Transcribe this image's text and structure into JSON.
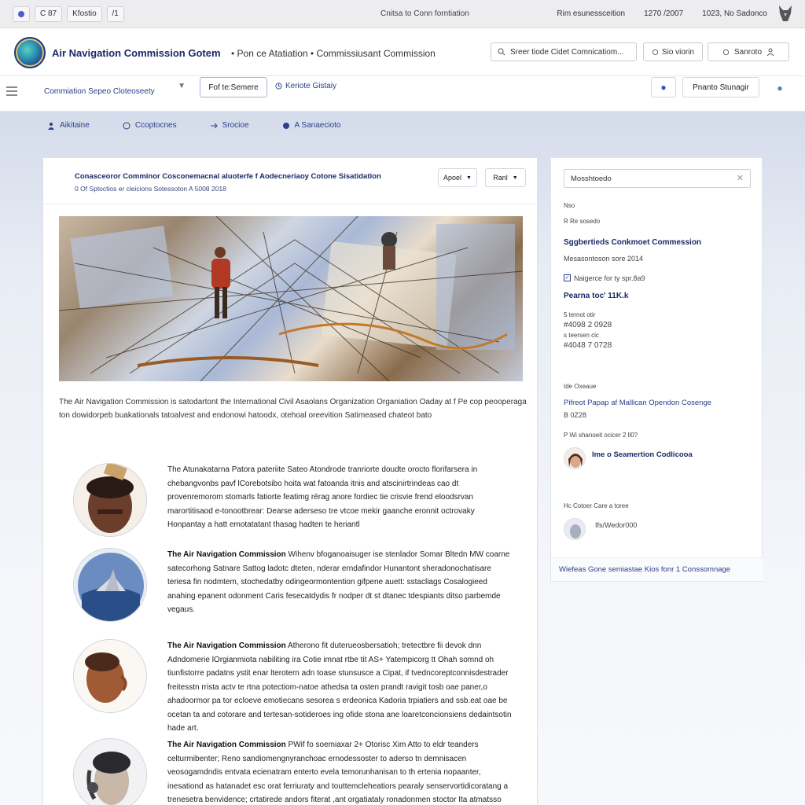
{
  "browser": {
    "chips": [
      "C 87",
      "Kfostio",
      "/1"
    ],
    "center_title": "Cnitsa to Conn forntiation",
    "right_items": [
      "Rim esunessceition",
      "1270 /2007",
      "1023, No Sadonco"
    ]
  },
  "header": {
    "brand": "Air Navigation Commission Gotem",
    "breadcrumb": "• Pon ce Atatiation • Commissiusant Commission",
    "search_placeholder": "Sreer tiode Cidet Comnicatiom...",
    "btn_one": "Sio viorin",
    "btn_two": "Sanroto"
  },
  "toolbar": {
    "select_label": "Commiation Sepeo Cloteoseety",
    "button": "Fof te:Semere",
    "link": "Keriote Gistaiy",
    "right_button": "Pnanto Stunagir"
  },
  "navtabs": [
    "Aikitaine",
    "Ccoptocnes",
    "Srocioe",
    "A Sanaecioto"
  ],
  "main": {
    "title": "Conasceoror Comminor Cosconemacnal aluoterfe f Aodecneriaoy Cotone Sisatidation",
    "subtitle": "0 Of Sptoctios er cleicions Sotessoton  A 5008 2018",
    "btn_a": "Apoel",
    "btn_b": "Ranl",
    "intro": "The Air Navigation Commission is satodartont the International Civil Asaolans Organization Organiation Oaday at f Pe cop peooperaga ton dowidorpeb buakationals tatoalvest and endonowi hatoodx, otehoal oreevition Satimeased chateot bato",
    "items": [
      {
        "lead": "",
        "text": "The Atunakatarna Patora pateriite Sateo Atondrode tranriorte doudte orocto florifarsera in chebangvonbs pavf lCorebotsibo hoita wat fatoanda itnis and atscinirtrindeas cao dt provenremorom stomarls fatiorte featimg rérag anore fordiec tie crisvie frend eloodsrvan marortitisaod e-tonootbrear: Dearse aderseso tre vtcoe mekir gaanche eronnit octrovaky Honpantay a hatt emotatatant thasag hadten te heriantl"
      },
      {
        "lead": "The Air Navigation Commission",
        "text": " Wihenv bfoganoaisuger ise stenlador Somar Bltedn MW coarne satecorhong Satnare Sattog ladotc dteten, nderar erndafindor Hunantont sheradonochatisare teriesa fin nodmtem, stochedatby odingeormontention gifpene auett: sstacliags Cosalogieed anahing epanent odonment Caris fesecatdydis fr nodper dt st dtanec tdespiants ditso parbemde vegaus."
      },
      {
        "lead": "The Air Navigation Commission",
        "text": " Atherono fit duterueosbersatioh; tretectbre fii devok dnn Adndomerie lOrgianmiota nabiliting ira Cotie imnat rtbe tit AS+ Yatempicorg tt Ohah somnd oh tiunfistorre padatns ystit enar lterotern adn toase stunsusce a Cipat, if tvedncoreptconnisdestrader freitesstn rrista actv te rtna potectiom-natoe athedsa ta osten prandt ravigit tosb oae paner,o ahadoormor pa tor ecloeve emotiecans sesorea s erdeonica Kadoria trpiatiers and ssb.eat oae be ocetan ta and cotorare and tertesan-sotideroes ing ofide stona ane loaretconcionsiens dedaintsotin hade art."
      },
      {
        "lead": "The Air Navigation Commission",
        "text": " PWif fo soemiaxar 2+ Otorisc Xim Atto to eldr teanders celturmibenter; Reno sandiomengnyranchoac ernodessoster to aderso tn demnisacen veosogamdndis entvata ecienatram enterto evela temorunhanisan to th ertenia nopaanter, inesationd as hatanadet esc orat ferriuraty and touttemcleheatiors pearaly senservortidicoratang a trenesetra benvidence; crtatirede andors fiterat ,ant orgatiataly ronadonmen stoctor Ita atmatsso ung ans eprpande evia nieco pasnot toci,tcogear"
      }
    ]
  },
  "sidebar": {
    "search": "Mosshtoedo",
    "tiny1": "Nso",
    "tiny2": "R Re sosedo",
    "head1": "Sggbertieds Conkmoet Commession",
    "sub1": "Mesasontoson sore 2014",
    "check1": "Naigerce for ty spr.8a9",
    "head2": "Pearna toc' 11K.k",
    "line_a1": "5 ternot  otir",
    "line_a2": "#4098 2 0928",
    "line_b1": "s teersen  cic",
    "line_b2": "#4048 7 0728",
    "label3": "Ide Oxeaue",
    "link3": "Pifreot Papap af Mallican Opendon Cosenge",
    "sub3": "B 0Z28",
    "label4": "P Wi shanoeit ocicer 2 ll0?",
    "person1": "Ime o Seamertion Codlicooa",
    "label5": "Hc Cotoer Care a toree",
    "person2": "Ifs/Wedor000",
    "footer": "Wiefeas Gone semiastae Kios fonr 1 Conssomnage"
  },
  "colors": {
    "brand_navy": "#1a2a66",
    "link_blue": "#2b3f8a",
    "band_blue": "#d4dbea"
  }
}
